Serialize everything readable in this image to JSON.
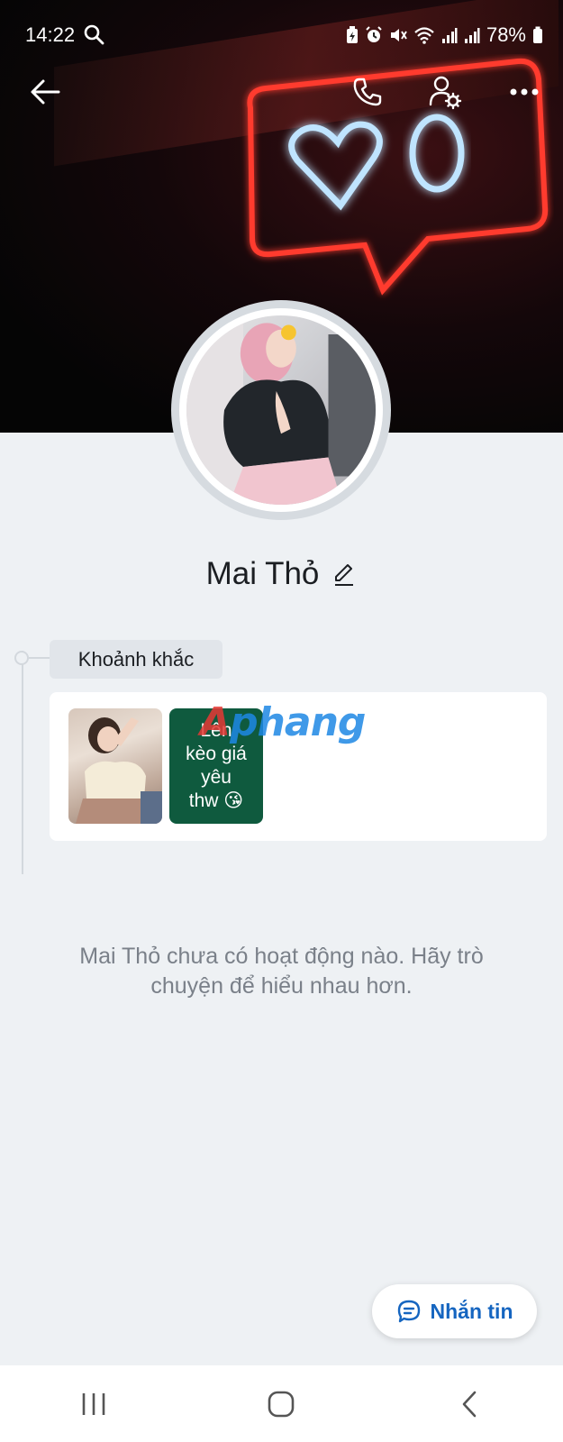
{
  "status_bar": {
    "time": "14:22",
    "battery": "78%",
    "icons": [
      "search-icon",
      "battery-saver-icon",
      "alarm-icon",
      "mute-icon",
      "wifi-icon",
      "signal-icon",
      "signal-icon",
      "battery-icon"
    ]
  },
  "toolbar": {
    "icons": [
      "back-arrow-icon",
      "phone-icon",
      "profile-settings-icon",
      "more-icon"
    ]
  },
  "profile": {
    "name": "Mai Thỏ",
    "edit_icon": "pencil-icon"
  },
  "moments": {
    "label": "Khoảnh khắc",
    "text_post": {
      "lines": [
        "Lên",
        "kèo giá",
        "yêu",
        "thw 😘"
      ],
      "background": "#0f5a3e"
    }
  },
  "watermark": {
    "first": "A",
    "rest": "phang"
  },
  "empty_state": {
    "message": "Mai Thỏ chưa có hoạt động nào. Hãy trò chuyện để hiểu nhau hơn."
  },
  "message_button": {
    "label": "Nhắn tin",
    "icon": "chat-bubble-icon",
    "color": "#1565c0"
  },
  "nav_bar": {
    "icons": [
      "recent-apps-icon",
      "home-icon",
      "back-icon"
    ]
  }
}
